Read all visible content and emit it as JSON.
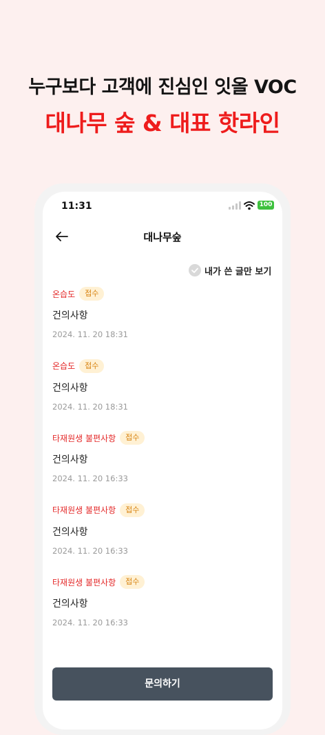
{
  "promo": {
    "headline": "누구보다 고객에 진심인 잇올 VOC",
    "subheadline": "대나무 숲 & 대표 핫라인"
  },
  "status_bar": {
    "time": "11:31",
    "battery": "100"
  },
  "nav": {
    "title": "대나무숲"
  },
  "filter": {
    "label": "내가 쓴 글만 보기",
    "checked": false
  },
  "posts": [
    {
      "category": "온습도",
      "status": "접수",
      "title": "건의사항",
      "date": "2024. 11. 20 18:31"
    },
    {
      "category": "온습도",
      "status": "접수",
      "title": "건의사항",
      "date": "2024. 11. 20 18:31"
    },
    {
      "category": "타재원생 불편사항",
      "status": "접수",
      "title": "건의사항",
      "date": "2024. 11. 20 16:33"
    },
    {
      "category": "타재원생 불편사항",
      "status": "접수",
      "title": "건의사항",
      "date": "2024. 11. 20 16:33"
    },
    {
      "category": "타재원생 불편사항",
      "status": "접수",
      "title": "건의사항",
      "date": "2024. 11. 20 16:33"
    }
  ],
  "cta": {
    "label": "문의하기"
  },
  "colors": {
    "accent_red": "#ee1c1c",
    "category_red": "#e42b2b",
    "badge_bg": "#fff1d4",
    "badge_text": "#d7820f",
    "button_bg": "#47525e",
    "page_bg": "#fdf0ef",
    "battery_green": "#3ec13e"
  },
  "icons": {
    "back": "arrow-left-icon",
    "filter": "check-circle-icon",
    "wifi": "wifi-icon",
    "signal": "signal-icon"
  }
}
